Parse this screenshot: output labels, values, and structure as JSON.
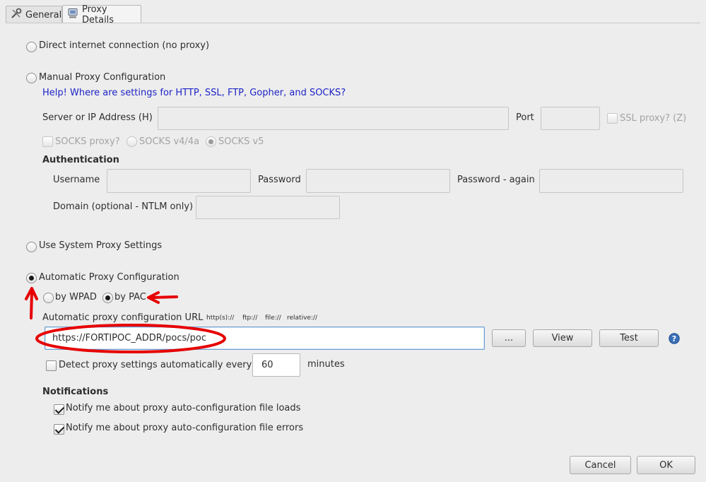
{
  "tabs": [
    {
      "label": "General",
      "icon": "wrench-screwdriver-icon"
    },
    {
      "label": "Proxy Details",
      "icon": "computer-icon"
    }
  ],
  "direct": {
    "label": "Direct internet connection (no proxy)"
  },
  "manual": {
    "label": "Manual Proxy Configuration",
    "help_link": "Help! Where are settings for HTTP, SSL, FTP, Gopher, and SOCKS?",
    "server_label": "Server or IP Address (H)",
    "port_label": "Port",
    "ssl_label": "SSL proxy? (Z)",
    "socks_label": "SOCKS proxy?",
    "socks4_label": "SOCKS v4/4a",
    "socks5_label": "SOCKS v5",
    "auth_heading": "Authentication",
    "username_label": "Username",
    "password_label": "Password",
    "password_again_label": "Password - again",
    "domain_label": "Domain (optional - NTLM only)"
  },
  "system": {
    "label": "Use System Proxy Settings"
  },
  "auto": {
    "label": "Automatic Proxy Configuration",
    "wpad_label": "by WPAD",
    "pac_label": "by PAC",
    "url_label": "Automatic proxy configuration URL",
    "schemes": [
      "http(s)://",
      "ftp://",
      "file://",
      "relative://"
    ],
    "url_value": "https://FORTIPOC_ADDR/pocs/poc",
    "browse_label": "...",
    "view_label": "View",
    "test_label": "Test",
    "detect_label": "Detect proxy settings automatically every",
    "detect_value": "60",
    "detect_unit": "minutes"
  },
  "notifications": {
    "heading": "Notifications",
    "loads_label": "Notify me about proxy auto-configuration file loads",
    "errors_label": "Notify me about proxy auto-configuration file errors"
  },
  "footer": {
    "cancel_label": "Cancel",
    "ok_label": "OK"
  },
  "colors": {
    "annotation": "#e60000",
    "link": "#1e24c6"
  }
}
